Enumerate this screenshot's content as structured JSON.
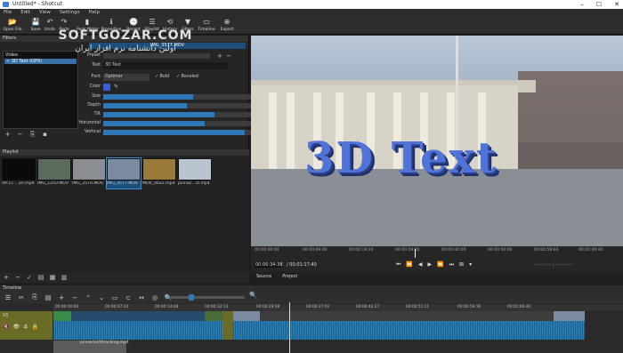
{
  "window": {
    "title": "Untitled* - Shotcut",
    "controls": [
      "–",
      "☐",
      "✕"
    ]
  },
  "menu": [
    "File",
    "Edit",
    "View",
    "Settings",
    "Help"
  ],
  "toolbar": [
    {
      "label": "Open File",
      "icon": "📂"
    },
    {
      "label": "Save",
      "icon": "💾"
    },
    {
      "label": "Undo",
      "icon": "↶"
    },
    {
      "label": "Redo",
      "icon": "↷"
    },
    {
      "label": "Peak Meter",
      "icon": "▮"
    },
    {
      "label": "Properties",
      "icon": "ℹ"
    },
    {
      "label": "Recent",
      "icon": "🕒"
    },
    {
      "label": "Playlist",
      "icon": "☰"
    },
    {
      "label": "History",
      "icon": "⟲"
    },
    {
      "label": "Filters",
      "icon": "▼"
    },
    {
      "label": "Timeline",
      "icon": "▭"
    },
    {
      "label": "Export",
      "icon": "⊕"
    }
  ],
  "watermark": "SOFTGOZAR.COM",
  "watermark_fa": "اولین دانشنامه نرم افزار ایران",
  "filters": {
    "header": "Filters",
    "clip": "IMG_3577.MOV",
    "video_label": "Video",
    "video_item": "✓ 3D Text (GPS)",
    "preset_label": "Preset",
    "text_label": "Text",
    "text_value": "3D Text",
    "font_label": "Font",
    "font_value": "Optimer",
    "bold_label": "✓ Bold",
    "beveled_label": "✓ Beveled",
    "color_label": "Color",
    "color": "#3a5fd0",
    "sliders": [
      {
        "label": "Size",
        "value": "108",
        "fraction": 0.45
      },
      {
        "label": "Depth",
        "value": "42 %",
        "fraction": 0.42
      },
      {
        "label": "Tilt",
        "value": "56 %",
        "fraction": 0.56
      },
      {
        "label": "Horizontal",
        "value": "51 %",
        "fraction": 0.51
      },
      {
        "label": "Vertical",
        "value": "71 %",
        "fraction": 0.71
      }
    ],
    "buttons": [
      "+",
      "−",
      "⎘",
      "▪"
    ]
  },
  "playlist": {
    "header": "Playlist",
    "items": [
      {
        "label": "09:11 ...on.mp4",
        "color": "#0a0a0a"
      },
      {
        "label": "IMG_1250.MOV",
        "color": "#5a6b5c"
      },
      {
        "label": "IMG_3570.MOV",
        "color": "#8a8d92"
      },
      {
        "label": "IMG_3577.MOV",
        "color": "#7a8aa0"
      },
      {
        "label": "MOV_0022.mp4",
        "color": "#9a7a3a"
      },
      {
        "label": "pinnac...ct.mp4",
        "color": "#b8c4d0"
      }
    ],
    "buttons": [
      "+",
      "−",
      "✓",
      "▤",
      "▦",
      "▥"
    ]
  },
  "viewer": {
    "overlay_text": "3D Text"
  },
  "ruler_ticks": [
    "00:00:00:00",
    "00:00:09:40",
    "00:00:19:20",
    "00:00:29:00",
    "00:00:40:00",
    "00:00:50:00",
    "00:00:59:60",
    "00:01:09:40"
  ],
  "transport": {
    "current": "00:00:34:38",
    "total": "/ 00:01:17:40",
    "buttons": [
      "⏮",
      "⏪",
      "◀",
      "▶",
      "⏩",
      "⏭",
      "⊠",
      "▾"
    ],
    "right_readout": "--:--:--:-- / --:--:--:--"
  },
  "source_tabs": [
    "Source",
    "Project"
  ],
  "timeline": {
    "header": "Timeline",
    "tools": [
      "☰",
      "✂",
      "⎘",
      "▤",
      "+",
      "−",
      "⌃",
      "⌄",
      "▭",
      "⊂",
      "↔",
      "◎",
      "🔍",
      "🔍"
    ],
    "ticks": [
      "00:00:00:00",
      "00:00:07:24",
      "00:00:14:48",
      "00:00:22:13",
      "00:00:29:38",
      "00:00:37:02",
      "00:00:44:27",
      "00:00:51:51",
      "00:00:59:16",
      "00:01:06:40"
    ],
    "track_name": "V1",
    "track_controls": [
      "🔇",
      "👁",
      "⚓",
      "🔒"
    ],
    "track2_label": "pinnacle20tracking.mp4"
  }
}
